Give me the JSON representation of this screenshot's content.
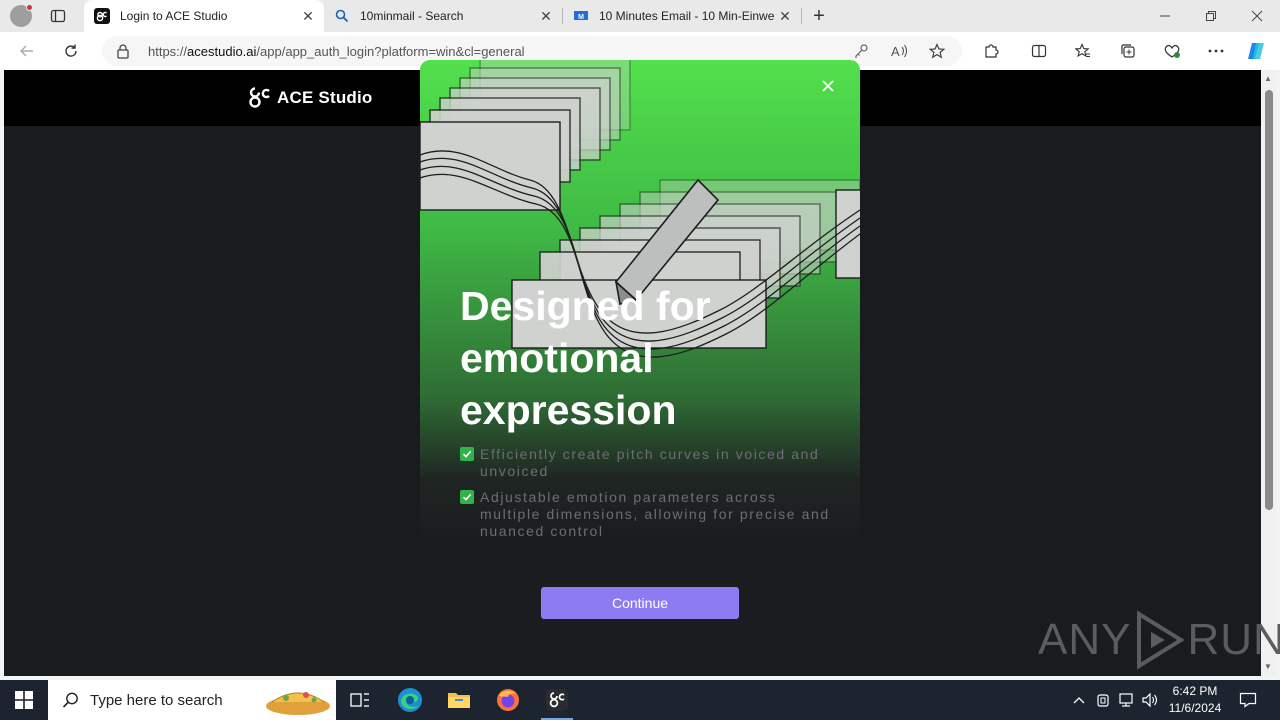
{
  "browser": {
    "tabs": [
      {
        "title": "Login to ACE Studio",
        "active": true,
        "icon": "ace-studio-favicon"
      },
      {
        "title": "10minmail - Search",
        "active": false,
        "icon": "search-favicon"
      },
      {
        "title": "10 Minutes Email - 10 Min-Einwe",
        "active": false,
        "icon": "tenminutemail-favicon"
      }
    ],
    "new_tab": "+",
    "window_controls": {
      "minimize": "—",
      "restore": "❐",
      "close": "✕"
    },
    "url_prefix": "https://",
    "url_host": "acestudio.ai",
    "url_path": "/app/app_auth_login?platform=win&cl=general"
  },
  "site": {
    "brand": "ACE Studio"
  },
  "modal": {
    "headline": "Designed for emotional expression",
    "features": [
      {
        "text": "Efficiently create pitch curves in voiced and unvoiced"
      },
      {
        "text": "Adjustable emotion parameters across multiple dimensions, allowing for precise and nuanced control"
      }
    ],
    "continue_label": "Continue",
    "close_label": "×"
  },
  "watermark": {
    "left": "ANY",
    "right": "RUN"
  },
  "taskbar": {
    "search_placeholder": "Type here to search",
    "time": "6:42 PM",
    "date": "11/6/2024"
  },
  "colors": {
    "accent_button": "#8b7cf4",
    "modal_green": "#52e04c",
    "page_bg": "#1a1b1f"
  }
}
